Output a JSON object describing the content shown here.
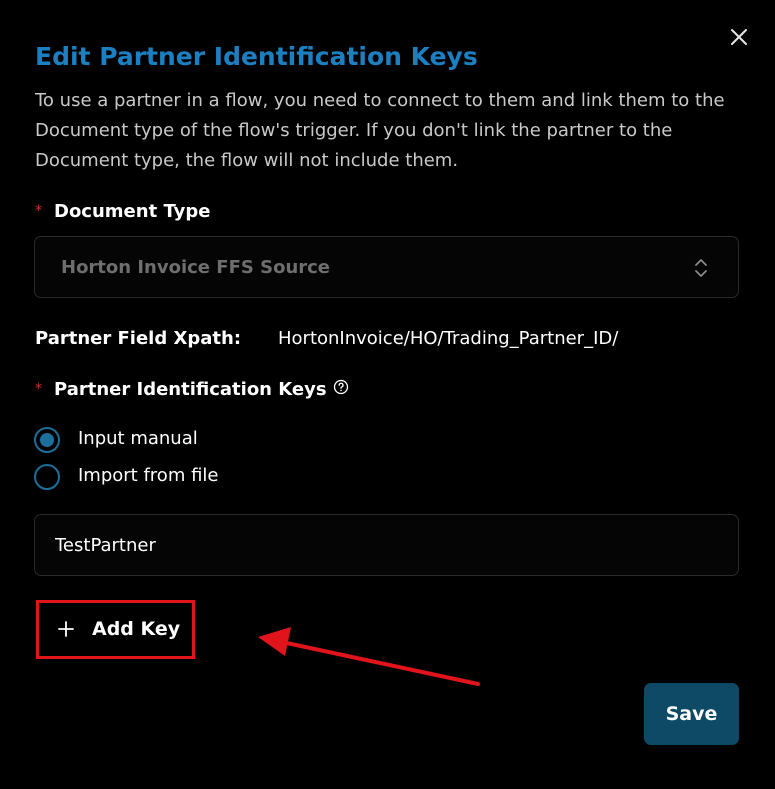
{
  "dialog": {
    "title": "Edit Partner Identification Keys",
    "description": "To use a partner in a flow, you need to connect to them and link them to the Document type of the flow's trigger. If you don't link the partner to the Document type, the flow will not include them.",
    "close_icon": "close-icon"
  },
  "document_type": {
    "required_marker": "*",
    "label": "Document Type",
    "selected_value": "Horton Invoice FFS Source",
    "chevron_icon": "chevron-up-down-icon"
  },
  "xpath": {
    "label": "Partner Field Xpath:",
    "value": "HortonInvoice/HO/Trading_Partner_ID/"
  },
  "keys": {
    "required_marker": "*",
    "label": "Partner Identification Keys",
    "help_icon": "help-circle-icon",
    "options": [
      {
        "label": "Input manual",
        "checked": true
      },
      {
        "label": "Import from file",
        "checked": false
      }
    ],
    "input_value": "TestPartner"
  },
  "actions": {
    "add_key_label": "Add Key",
    "add_key_icon": "plus-icon",
    "save_label": "Save"
  },
  "colors": {
    "title": "#1c7fc0",
    "required": "#d9322b",
    "radio": "#1c6f9a",
    "save_button": "#0e4a66",
    "annotation": "#e0141a"
  }
}
